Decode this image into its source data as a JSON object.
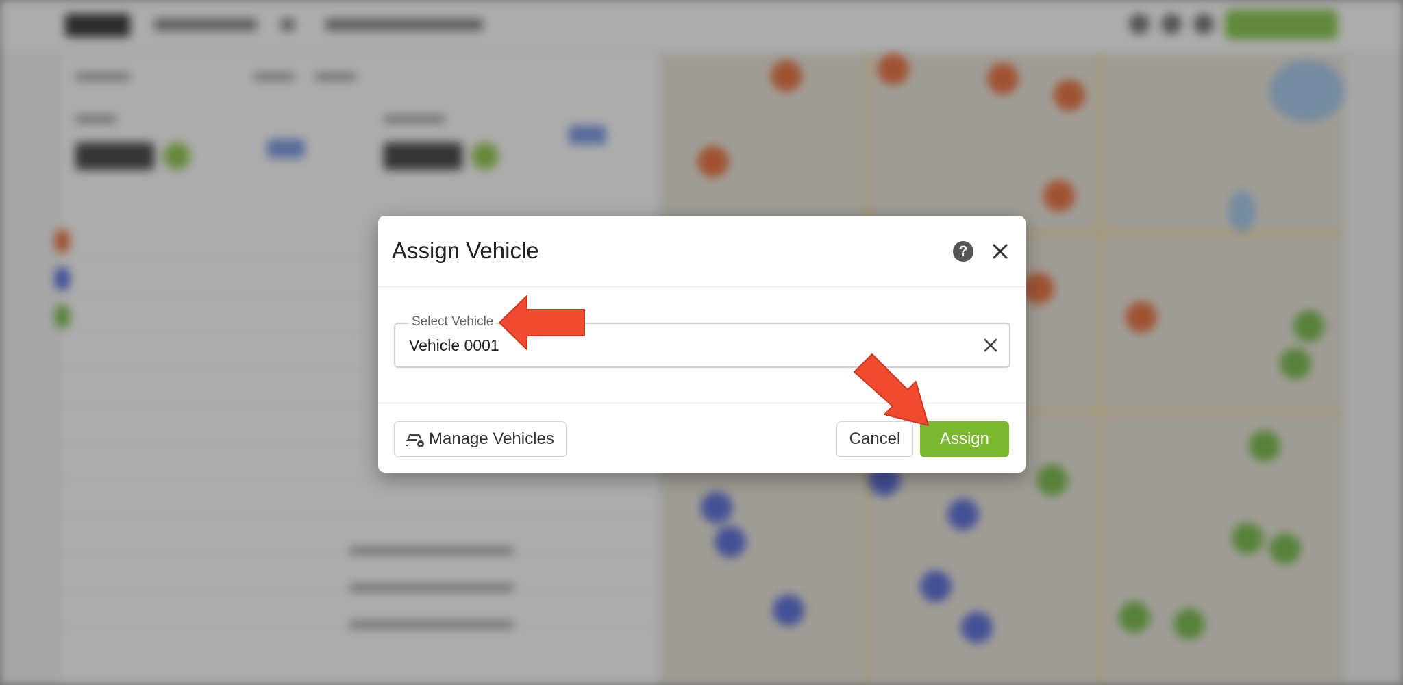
{
  "modal": {
    "title": "Assign Vehicle",
    "help_icon": "question-circle-icon",
    "close_icon": "close-icon",
    "field": {
      "label": "Select Vehicle",
      "value": "Vehicle 0001",
      "clear_icon": "clear-icon"
    },
    "footer": {
      "manage_label": "Manage Vehicles",
      "manage_icon": "car-gear-icon",
      "cancel_label": "Cancel",
      "assign_label": "Assign"
    }
  },
  "colors": {
    "assign_green": "#7cb82f",
    "arrow_red": "#f04a30",
    "route_orange": "#e8642c",
    "route_green": "#6cb53a",
    "route_blue": "#4a5fd8"
  }
}
